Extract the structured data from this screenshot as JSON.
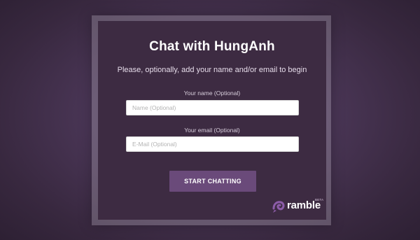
{
  "dialog": {
    "title": "Chat with HungAnh",
    "subtitle": "Please, optionally, add your name and/or email to begin"
  },
  "form": {
    "name_label": "Your name (Optional)",
    "name_placeholder": "Name (Optional)",
    "name_value": "",
    "email_label": "Your email (Optional)",
    "email_placeholder": "E-Mail (Optional)",
    "email_value": "",
    "submit_label": "START CHATTING"
  },
  "brand": {
    "name": "ramble",
    "badge": "BETA",
    "icon": "ramble-logo-icon"
  },
  "colors": {
    "panel": "#3d2b42",
    "button": "#6a4a7a",
    "background": "#4a3656",
    "accent": "#8c5ca8"
  }
}
